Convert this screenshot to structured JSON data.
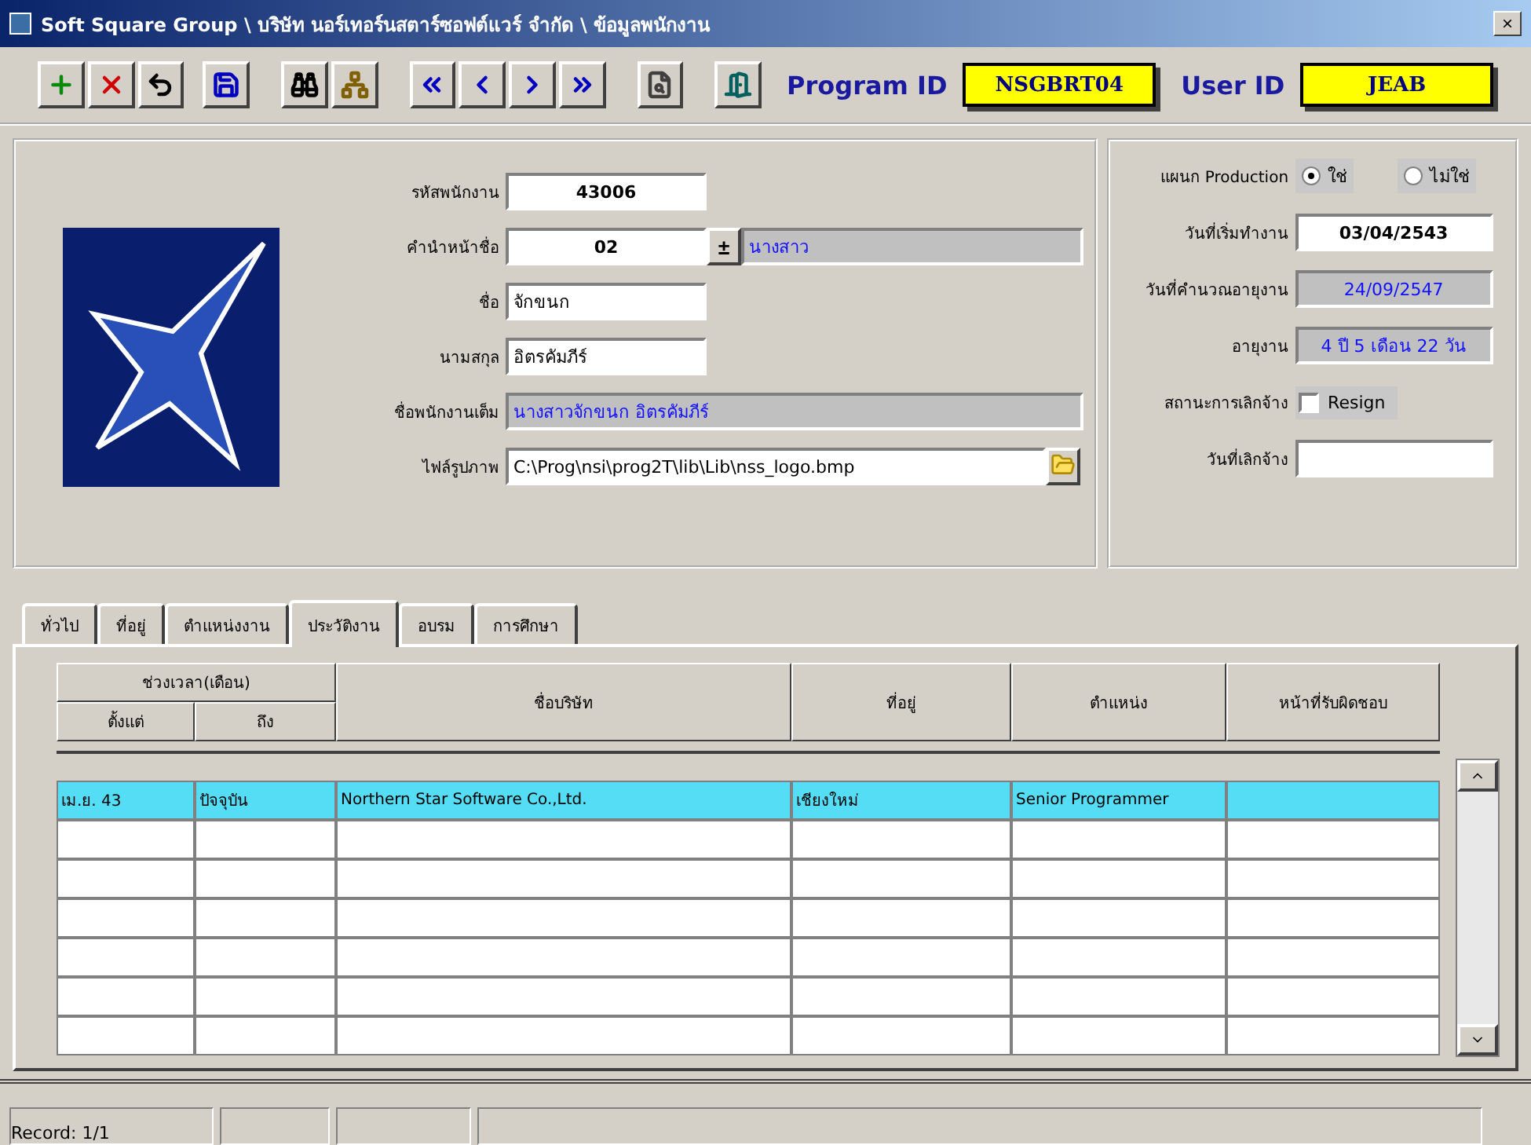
{
  "window": {
    "title": "Soft Square Group \\ บริษัท นอร์เทอร์นสตาร์ซอฟต์แวร์ จำกัด \\ ข้อมูลพนักงาน",
    "close": "×"
  },
  "toolbar": {
    "program_id_label": "Program ID",
    "program_id": "NSGBRT04",
    "user_id_label": "User ID",
    "user_id": "JEAB"
  },
  "employee": {
    "fields": [
      {
        "kind": "code",
        "label": "รหัสพนักงาน",
        "value": "43006"
      },
      {
        "kind": "lookup",
        "label": "คำนำหน้าชื่อ",
        "value": "02",
        "button": "±",
        "lookup": "นางสาว"
      },
      {
        "kind": "input",
        "label": "ชื่อ",
        "value": "จักขนก"
      },
      {
        "kind": "input",
        "label": "นามสกุล",
        "value": "อิตรคัมภีร์"
      },
      {
        "kind": "display",
        "label": "ชื่อพนักงานเต็ม",
        "value": "นางสาวจักขนก อิตรคัมภีร์"
      },
      {
        "kind": "file",
        "label": "ไฟล์รูปภาพ",
        "value": "C:\\Prog\\nsi\\prog2T\\lib\\Lib\\nss_logo.bmp"
      }
    ]
  },
  "work": {
    "production_label": "แผนก Production",
    "production_options": [
      {
        "label": "ใช่",
        "selected": true
      },
      {
        "label": "ไม่ใช่",
        "selected": false
      }
    ],
    "fields": [
      {
        "kind": "code",
        "label": "วันที่เริ่มทำงาน",
        "value": "03/04/2543"
      },
      {
        "kind": "display",
        "label": "วันที่คำนวณอายุงาน",
        "value": "24/09/2547"
      },
      {
        "kind": "display",
        "label": "อายุงาน",
        "value": "4 ปี 5 เดือน 22 วัน"
      },
      {
        "kind": "checkbox",
        "label": "สถานะการเลิกจ้าง",
        "text": "Resign",
        "checked": false
      },
      {
        "kind": "input",
        "label": "วันที่เลิกจ้าง"
      }
    ]
  },
  "tabs": [
    {
      "label": "ทั่วไป",
      "selected": false
    },
    {
      "label": "ที่อยู่",
      "selected": false
    },
    {
      "label": "ตำแหน่งงาน",
      "selected": false
    },
    {
      "label": "ประวัติงาน",
      "selected": true
    },
    {
      "label": "อบรม",
      "selected": false
    },
    {
      "label": "การศึกษา",
      "selected": false
    }
  ],
  "table": {
    "group_header": "ช่วงเวลา(เดือน)",
    "columns": [
      "ตั้งแต่",
      "ถึง",
      "ชื่อบริษัท",
      "ที่อยู่",
      "ตำแหน่ง",
      "หน้าที่รับผิดชอบ"
    ],
    "rows": [
      {
        "selected": true,
        "cells": [
          "เม.ย. 43",
          "ปัจจุบัน",
          "Northern Star Software Co.,Ltd.",
          "เชียงใหม่",
          "Senior Programmer"
        ]
      }
    ]
  },
  "status_bar": {
    "record": "Record: 1/1"
  }
}
